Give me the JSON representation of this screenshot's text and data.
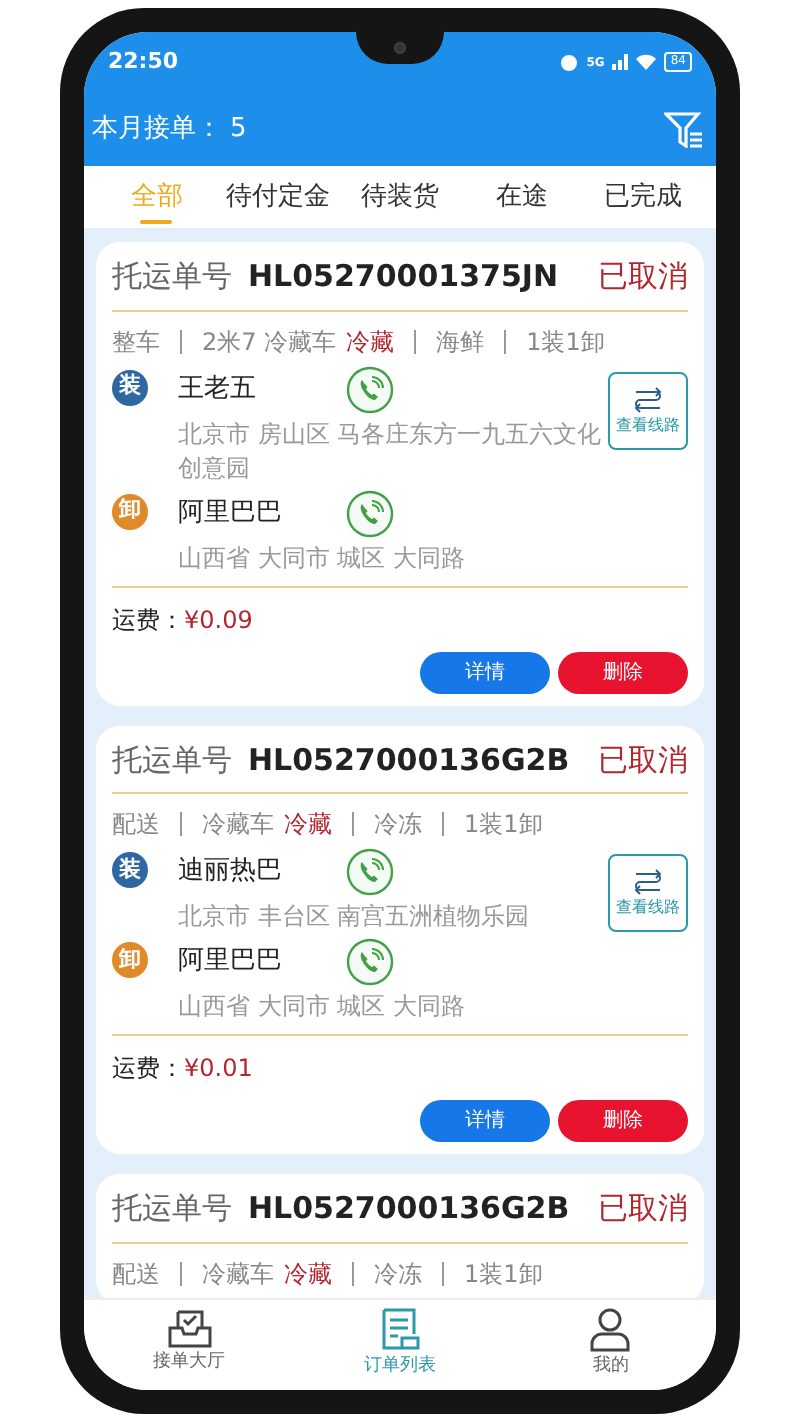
{
  "status_bar": {
    "time": "22:50",
    "signal": "5G",
    "battery": "84"
  },
  "header": {
    "label": "本月接单：",
    "count": "5"
  },
  "tabs": [
    {
      "label": "全部",
      "selected": true
    },
    {
      "label": "待付定金",
      "selected": false
    },
    {
      "label": "待装货",
      "selected": false
    },
    {
      "label": "在途",
      "selected": false
    },
    {
      "label": "已完成",
      "selected": false
    }
  ],
  "orders": [
    {
      "number_label": "托运单号",
      "number": "HL05270001375JN",
      "status": "已取消",
      "tag_groups": [
        {
          "items": [
            {
              "text": "整车",
              "highlight": false
            }
          ]
        },
        {
          "items": [
            {
              "text": "2米7 冷藏车",
              "highlight": false
            },
            {
              "text": "冷藏",
              "highlight": true
            }
          ]
        },
        {
          "items": [
            {
              "text": "海鲜",
              "highlight": false
            }
          ]
        },
        {
          "items": [
            {
              "text": "1装1卸",
              "highlight": false
            }
          ]
        }
      ],
      "stops": [
        {
          "kind": "load",
          "badge": "装",
          "name": "王老五",
          "address": "北京市 房山区 马各庄东方一九五六文化创意园"
        },
        {
          "kind": "unload",
          "badge": "卸",
          "name": "阿里巴巴",
          "address": "山西省 大同市 城区 大同路"
        }
      ],
      "route_label": "查看线路",
      "fee_label": "运费：",
      "fee": "¥0.09",
      "actions": [
        {
          "label": "详情",
          "kind": "primary"
        },
        {
          "label": "删除",
          "kind": "danger"
        }
      ]
    },
    {
      "number_label": "托运单号",
      "number": "HL0527000136G2B",
      "status": "已取消",
      "tag_groups": [
        {
          "items": [
            {
              "text": "配送",
              "highlight": false
            }
          ]
        },
        {
          "items": [
            {
              "text": "冷藏车",
              "highlight": false
            },
            {
              "text": "冷藏",
              "highlight": true
            }
          ]
        },
        {
          "items": [
            {
              "text": "冷冻",
              "highlight": false
            }
          ]
        },
        {
          "items": [
            {
              "text": "1装1卸",
              "highlight": false
            }
          ]
        }
      ],
      "stops": [
        {
          "kind": "load",
          "badge": "装",
          "name": "迪丽热巴",
          "address": "北京市 丰台区 南宫五洲植物乐园"
        },
        {
          "kind": "unload",
          "badge": "卸",
          "name": "阿里巴巴",
          "address": "山西省 大同市 城区 大同路"
        }
      ],
      "route_label": "查看线路",
      "fee_label": "运费：",
      "fee": "¥0.01",
      "actions": [
        {
          "label": "详情",
          "kind": "primary"
        },
        {
          "label": "删除",
          "kind": "danger"
        }
      ]
    },
    {
      "number_label": "托运单号",
      "number": "HL0527000136G2B",
      "status": "已取消",
      "tag_groups": [
        {
          "items": [
            {
              "text": "配送",
              "highlight": false
            }
          ]
        },
        {
          "items": [
            {
              "text": "冷藏车",
              "highlight": false
            },
            {
              "text": "冷藏",
              "highlight": true
            }
          ]
        },
        {
          "items": [
            {
              "text": "冷冻",
              "highlight": false
            }
          ]
        },
        {
          "items": [
            {
              "text": "1装1卸",
              "highlight": false
            }
          ]
        }
      ]
    }
  ],
  "bottom_nav": [
    {
      "kind": "hall",
      "label": "接单大厅",
      "selected": false
    },
    {
      "kind": "orders",
      "label": "订单列表",
      "selected": true
    },
    {
      "kind": "profile",
      "label": "我的",
      "selected": false
    }
  ]
}
